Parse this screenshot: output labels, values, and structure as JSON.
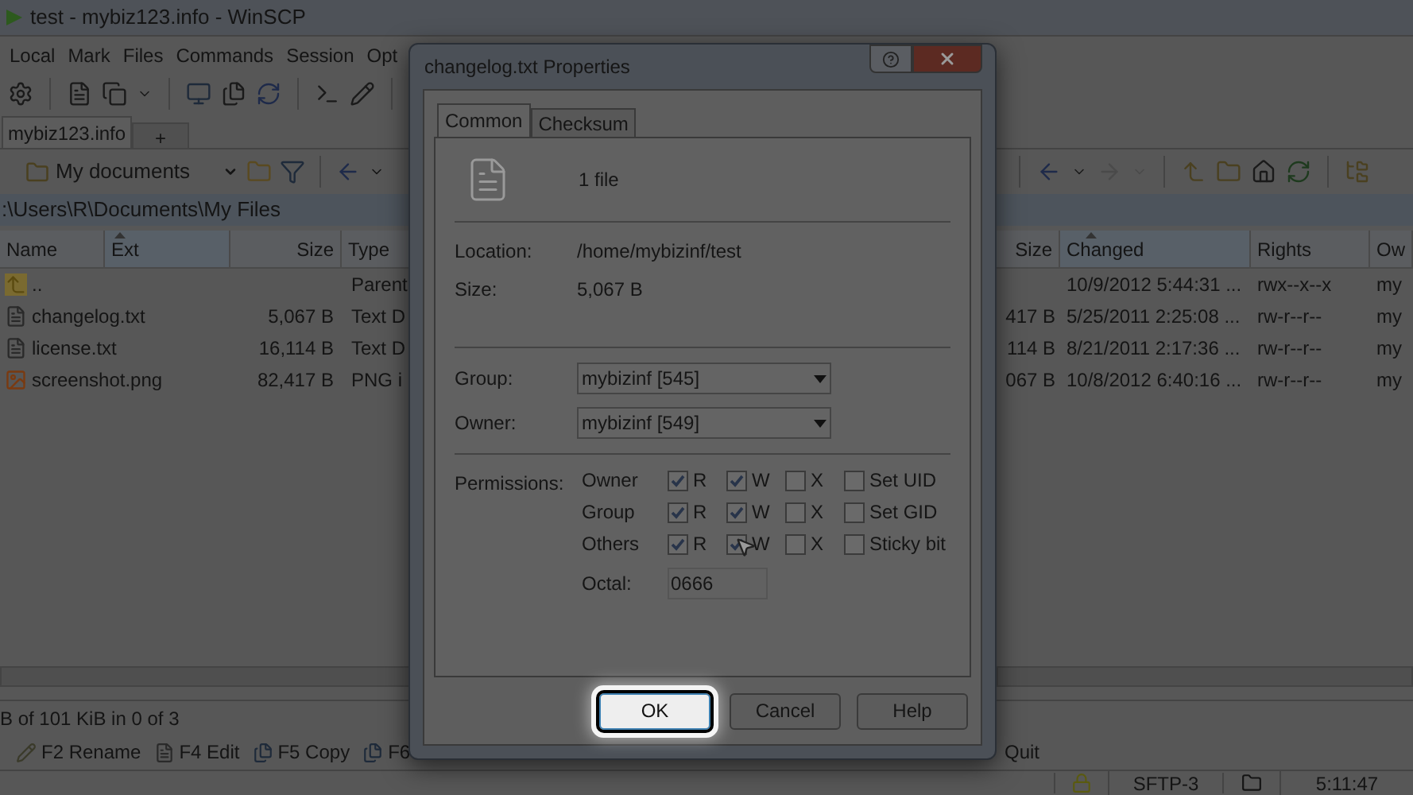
{
  "window": {
    "title": "test - mybiz123.info - WinSCP"
  },
  "menu": [
    "Local",
    "Mark",
    "Files",
    "Commands",
    "Session",
    "Opt"
  ],
  "session_tabs": [
    {
      "label": "mybiz123.info",
      "selected": true
    },
    {
      "label": "+",
      "selected": false
    }
  ],
  "location_dropdown": {
    "value": "My documents"
  },
  "path": ":\\Users\\R\\Documents\\My Files",
  "left_panel": {
    "columns": [
      {
        "label": "Name",
        "sorted": false
      },
      {
        "label": "Ext",
        "sorted": true
      },
      {
        "label": "Size",
        "sorted": false
      },
      {
        "label": "Type",
        "sorted": false
      }
    ],
    "rows": [
      {
        "kind": "parent",
        "name": "..",
        "type": "Parent"
      },
      {
        "kind": "text",
        "name": "changelog.txt",
        "size": "5,067 B",
        "type": "Text D"
      },
      {
        "kind": "text",
        "name": "license.txt",
        "size": "16,114 B",
        "type": "Text D"
      },
      {
        "kind": "image",
        "name": "screenshot.png",
        "size": "82,417 B",
        "type": "PNG i"
      }
    ]
  },
  "right_panel": {
    "columns": [
      {
        "label": "Size",
        "sorted": false
      },
      {
        "label": "Changed",
        "sorted": true
      },
      {
        "label": "Rights",
        "sorted": false
      },
      {
        "label": "Ow",
        "sorted": false
      }
    ],
    "rows": [
      {
        "changed": "10/9/2012 5:44:31 ...",
        "rights": "rwx--x--x",
        "owner": "my"
      },
      {
        "size": "417 B",
        "changed": "5/25/2011 2:25:08 ...",
        "rights": "rw-r--r--",
        "owner": "my"
      },
      {
        "size": "114 B",
        "changed": "8/21/2011 2:17:36 ...",
        "rights": "rw-r--r--",
        "owner": "my"
      },
      {
        "size": "067 B",
        "changed": "10/8/2012 6:40:16 ...",
        "rights": "rw-r--r--",
        "owner": "my"
      }
    ]
  },
  "selection_status": "B of 101 KiB in 0 of 3",
  "function_keys": [
    {
      "kind": "rename",
      "label": "F2 Rename"
    },
    {
      "kind": "edit",
      "label": "F4 Edit"
    },
    {
      "kind": "copy",
      "label": "F5 Copy"
    },
    {
      "kind": "copy",
      "label": "F6"
    }
  ],
  "quit_key": "Quit",
  "status_bar": {
    "protocol": "SFTP-3",
    "time": "5:11:47"
  },
  "dialog": {
    "title": "changelog.txt Properties",
    "tabs": [
      {
        "label": "Common",
        "selected": true
      },
      {
        "label": "Checksum",
        "selected": false
      }
    ],
    "file_count": "1 file",
    "info": [
      {
        "label": "Location:",
        "value": "/home/mybizinf/test"
      },
      {
        "label": "Size:",
        "value": "5,067 B"
      }
    ],
    "selects": [
      {
        "label": "Group:",
        "value": "mybizinf [545]"
      },
      {
        "label": "Owner:",
        "value": "mybizinf [549]"
      }
    ],
    "permissions": {
      "label": "Permissions:",
      "rows": [
        {
          "label": "Owner",
          "checks": [
            {
              "label": "R",
              "checked": true
            },
            {
              "label": "W",
              "checked": true
            },
            {
              "label": "X",
              "checked": false
            }
          ],
          "special": {
            "label": "Set UID",
            "checked": false
          }
        },
        {
          "label": "Group",
          "checks": [
            {
              "label": "R",
              "checked": true
            },
            {
              "label": "W",
              "checked": true
            },
            {
              "label": "X",
              "checked": false
            }
          ],
          "special": {
            "label": "Set GID",
            "checked": false
          }
        },
        {
          "label": "Others",
          "checks": [
            {
              "label": "R",
              "checked": true
            },
            {
              "label": "W",
              "checked": true
            },
            {
              "label": "X",
              "checked": false
            }
          ],
          "special": {
            "label": "Sticky bit",
            "checked": false
          }
        }
      ]
    },
    "octal": {
      "label": "Octal:",
      "value": "0666"
    },
    "buttons": [
      {
        "label": "OK",
        "focused": true
      },
      {
        "label": "Cancel",
        "focused": false
      },
      {
        "label": "Help",
        "focused": false
      }
    ]
  }
}
